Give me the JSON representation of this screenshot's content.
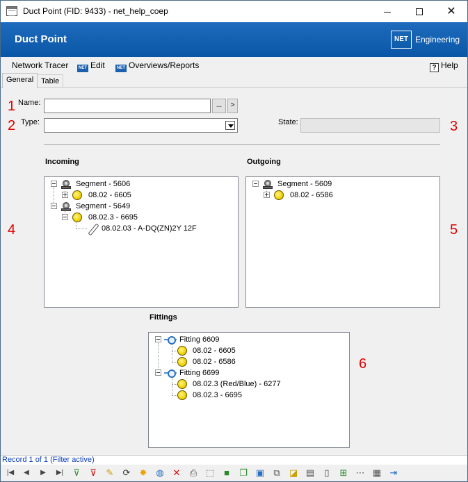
{
  "window": {
    "title": "Duct Point (FID: 9433) - net_help_coep"
  },
  "banner": {
    "heading": "Duct Point",
    "brand_box": "NET",
    "brand_text": "Engineering"
  },
  "menu": {
    "items": [
      {
        "label": "Network Tracer"
      },
      {
        "label": "Edit"
      },
      {
        "label": "Overviews/Reports"
      }
    ],
    "help": "Help",
    "icon_tag": "NET"
  },
  "tabs": [
    {
      "label": "General",
      "active": true
    },
    {
      "label": "Table",
      "active": false
    }
  ],
  "form": {
    "name_label": "Name:",
    "name_value": "",
    "browse_label": "...",
    "go_label": ">",
    "type_label": "Type:",
    "type_value": "",
    "state_label": "State:",
    "state_value": ""
  },
  "markers": [
    "1",
    "2",
    "3",
    "4",
    "5",
    "6"
  ],
  "incoming": {
    "title": "Incoming",
    "nodes": [
      {
        "label": "Segment - 5606",
        "icon": "segment-icon"
      },
      {
        "label": "08.02 - 6605",
        "icon": "duct-icon"
      },
      {
        "label": "Segment - 5649",
        "icon": "segment-icon"
      },
      {
        "label": "08.02.3 - 6695",
        "icon": "duct-icon"
      },
      {
        "label": "08.02.03 - A-DQ(ZN)2Y 12F",
        "icon": "cable-icon"
      }
    ]
  },
  "outgoing": {
    "title": "Outgoing",
    "nodes": [
      {
        "label": "Segment - 5609",
        "icon": "segment-icon"
      },
      {
        "label": "08.02 - 6586",
        "icon": "duct-icon"
      }
    ]
  },
  "fittings": {
    "title": "Fittings",
    "nodes": [
      {
        "label": "Fitting 6609",
        "icon": "fitting-icon"
      },
      {
        "label": "08.02 - 6605",
        "icon": "duct-icon"
      },
      {
        "label": "08.02 - 6586",
        "icon": "duct-icon"
      },
      {
        "label": "Fitting 6699",
        "icon": "fitting-icon"
      },
      {
        "label": "08.02.3 (Red/Blue) - 6277",
        "icon": "duct-icon"
      },
      {
        "label": "08.02.3 - 6695",
        "icon": "duct-icon"
      }
    ]
  },
  "status": {
    "text": "Record 1 of 1 (Filter active)"
  },
  "colors": {
    "banner": "#0a56a6",
    "marker": "#e00000",
    "status_text": "#0b3db8"
  }
}
